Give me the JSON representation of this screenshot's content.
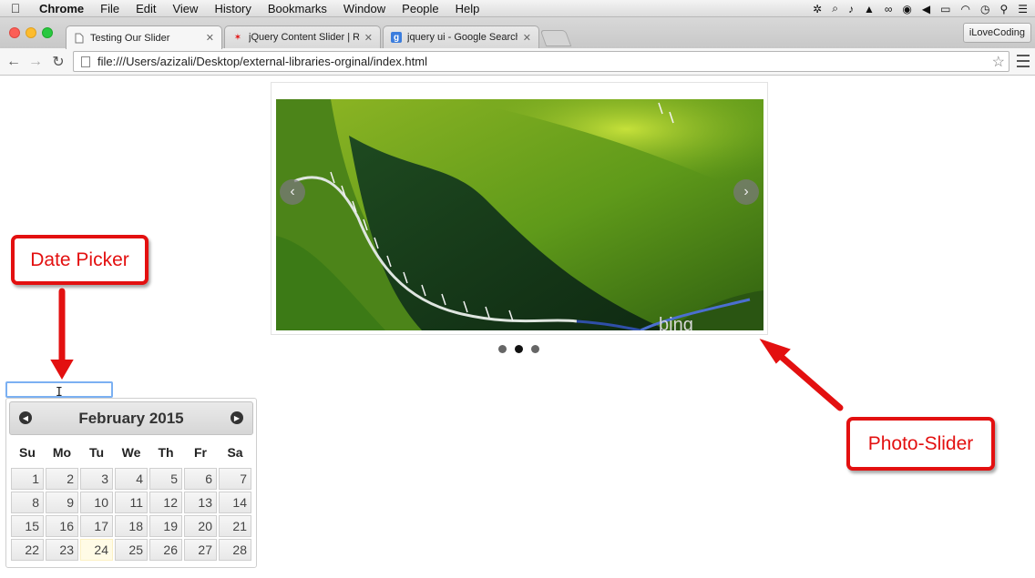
{
  "menubar": {
    "app": "Chrome",
    "items": [
      "File",
      "Edit",
      "View",
      "History",
      "Bookmarks",
      "Window",
      "People",
      "Help"
    ]
  },
  "tabs": [
    {
      "title": "Testing Our Slider",
      "active": true,
      "favicon": "page-icon"
    },
    {
      "title": "jQuery Content Slider | Re",
      "active": false,
      "favicon": "star-icon"
    },
    {
      "title": "jquery ui - Google Search",
      "active": false,
      "favicon": "google-icon"
    }
  ],
  "profile_button": "iLoveCoding",
  "address_bar": {
    "url": "file:///Users/azizali/Desktop/external-libraries-orginal/index.html"
  },
  "slider": {
    "image_watermark": "bing",
    "dots": 3,
    "active_dot": 1
  },
  "datepicker": {
    "title": "February 2015",
    "weekdays": [
      "Su",
      "Mo",
      "Tu",
      "We",
      "Th",
      "Fr",
      "Sa"
    ],
    "weeks": [
      [
        "1",
        "2",
        "3",
        "4",
        "5",
        "6",
        "7"
      ],
      [
        "8",
        "9",
        "10",
        "11",
        "12",
        "13",
        "14"
      ],
      [
        "15",
        "16",
        "17",
        "18",
        "19",
        "20",
        "21"
      ],
      [
        "22",
        "23",
        "24",
        "25",
        "26",
        "27",
        "28"
      ]
    ],
    "today": "24"
  },
  "annotations": {
    "date_picker": "Date Picker",
    "photo_slider": "Photo-Slider",
    "color": "#e31010"
  }
}
